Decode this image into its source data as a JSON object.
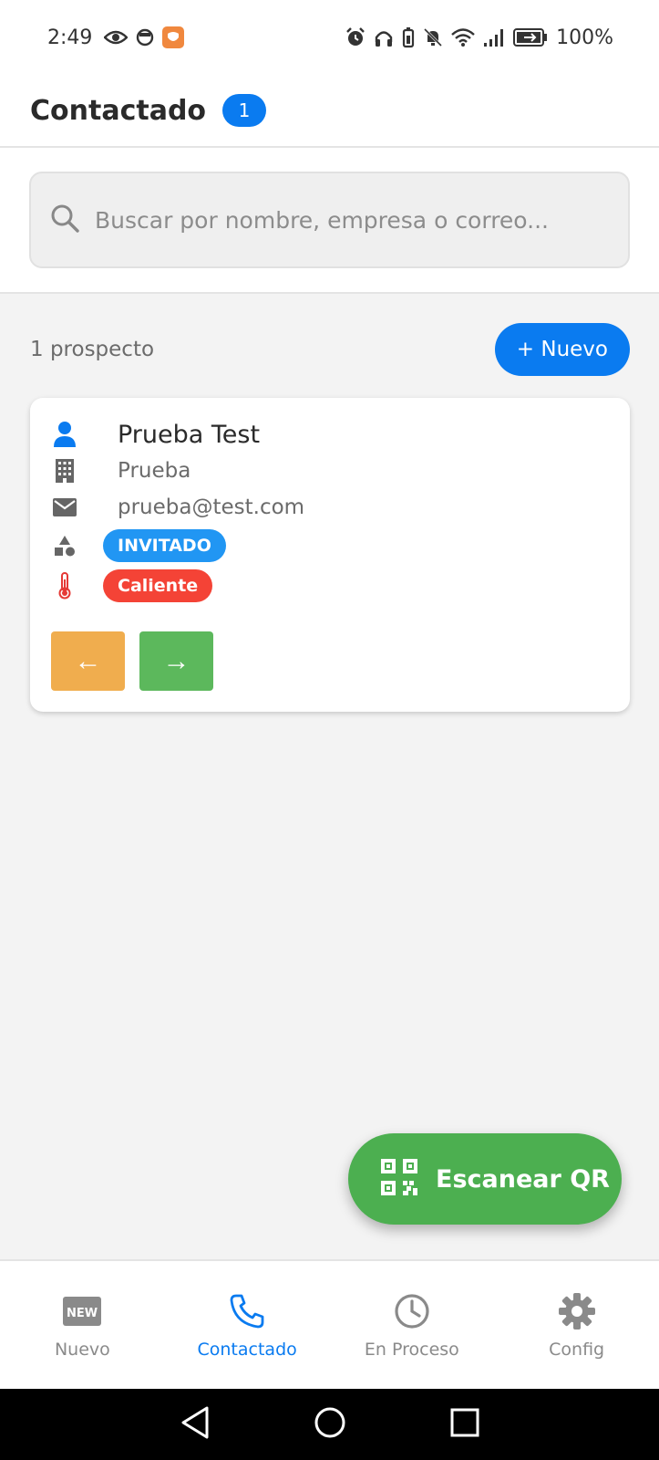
{
  "status_bar": {
    "time": "2:49",
    "battery": "100%",
    "left_icons": [
      "eye-icon",
      "face-icon",
      "app-shield-icon"
    ],
    "right_icons": [
      "alarm-icon",
      "headphones-icon",
      "battery-saver-icon",
      "bell-off-icon",
      "wifi-icon",
      "signal-icon",
      "battery-icon"
    ]
  },
  "header": {
    "title": "Contactado",
    "badge": "1"
  },
  "search": {
    "placeholder": "Buscar por nombre, empresa o correo...",
    "value": ""
  },
  "list": {
    "count_text": "1 prospecto",
    "new_button": "+ Nuevo"
  },
  "prospects": [
    {
      "name": "Prueba Test",
      "company": "Prueba",
      "email": "prueba@test.com",
      "status": "INVITADO",
      "temperature": "Caliente",
      "prev_arrow": "←",
      "next_arrow": "→"
    }
  ],
  "fab": {
    "label": "Escanear QR"
  },
  "bottom_nav": {
    "items": [
      {
        "label": "Nuevo",
        "icon": "new-badge-icon",
        "active": false
      },
      {
        "label": "Contactado",
        "icon": "phone-icon",
        "active": true
      },
      {
        "label": "En Proceso",
        "icon": "clock-icon",
        "active": false
      },
      {
        "label": "Config",
        "icon": "gear-icon",
        "active": false
      }
    ]
  },
  "colors": {
    "primary": "#0a7bf0",
    "status_blue": "#2196f3",
    "temp_red": "#f44336",
    "prev_orange": "#f0ad4e",
    "next_green": "#5cb85c",
    "fab_green": "#4caf50"
  }
}
